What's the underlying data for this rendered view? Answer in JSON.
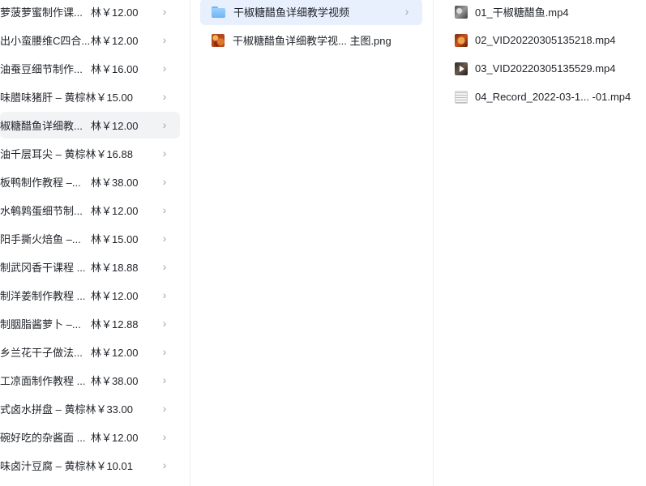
{
  "column1": {
    "items": [
      {
        "name": "萝菠萝蜜制作课...",
        "price": "林￥12.00"
      },
      {
        "name": "出小蛮腰维C四合...",
        "price": "林￥12.00"
      },
      {
        "name": "油蚕豆细节制作...",
        "price": "林￥16.00"
      },
      {
        "name": "味腊味猪肝 – 黄棕林￥15.00",
        "price": ""
      },
      {
        "name": "椒糖醋鱼详细教...",
        "price": "林￥12.00"
      },
      {
        "name": "油千层耳尖 – 黄棕林￥16.88",
        "price": ""
      },
      {
        "name": "板鸭制作教程 –...",
        "price": "林￥38.00"
      },
      {
        "name": "水鹌鹑蛋细节制...",
        "price": "林￥12.00"
      },
      {
        "name": "阳手撕火焙鱼 –...",
        "price": "林￥15.00"
      },
      {
        "name": "制武冈香干课程 ...",
        "price": "林￥18.88"
      },
      {
        "name": "制洋姜制作教程 ...",
        "price": "林￥12.00"
      },
      {
        "name": "制胭脂酱萝卜 –...",
        "price": "林￥12.88"
      },
      {
        "name": "乡兰花干子做法...",
        "price": "林￥12.00"
      },
      {
        "name": "工凉面制作教程 ...",
        "price": "林￥38.00"
      },
      {
        "name": "式卤水拼盘 – 黄棕林￥33.00",
        "price": ""
      },
      {
        "name": "碗好吃的杂酱面 ...",
        "price": "林￥12.00"
      },
      {
        "name": "味卤汁豆腐 – 黄棕林￥10.01",
        "price": ""
      }
    ]
  },
  "column2": {
    "items": [
      {
        "label": "干椒糖醋鱼详细教学视频",
        "icon": "folder-icon"
      },
      {
        "label": "干椒糖醋鱼详细教学视...  主图.png",
        "icon": "image-thumbnail-icon"
      }
    ]
  },
  "column3": {
    "items": [
      {
        "label": "01_干椒糖醋鱼.mp4",
        "icon": "video-thumbnail-icon"
      },
      {
        "label": "02_VID20220305135218.mp4",
        "icon": "video-thumbnail-icon"
      },
      {
        "label": "03_VID20220305135529.mp4",
        "icon": "video-thumbnail-icon"
      },
      {
        "label": "04_Record_2022-03-1...  -01.mp4",
        "icon": "video-thumbnail-icon"
      }
    ]
  },
  "chevron_glyph": "›",
  "colors": {
    "selected_folder_bg": "#e8f0fe",
    "selected_row_bg": "#f2f3f5",
    "divider": "#eceef2"
  }
}
